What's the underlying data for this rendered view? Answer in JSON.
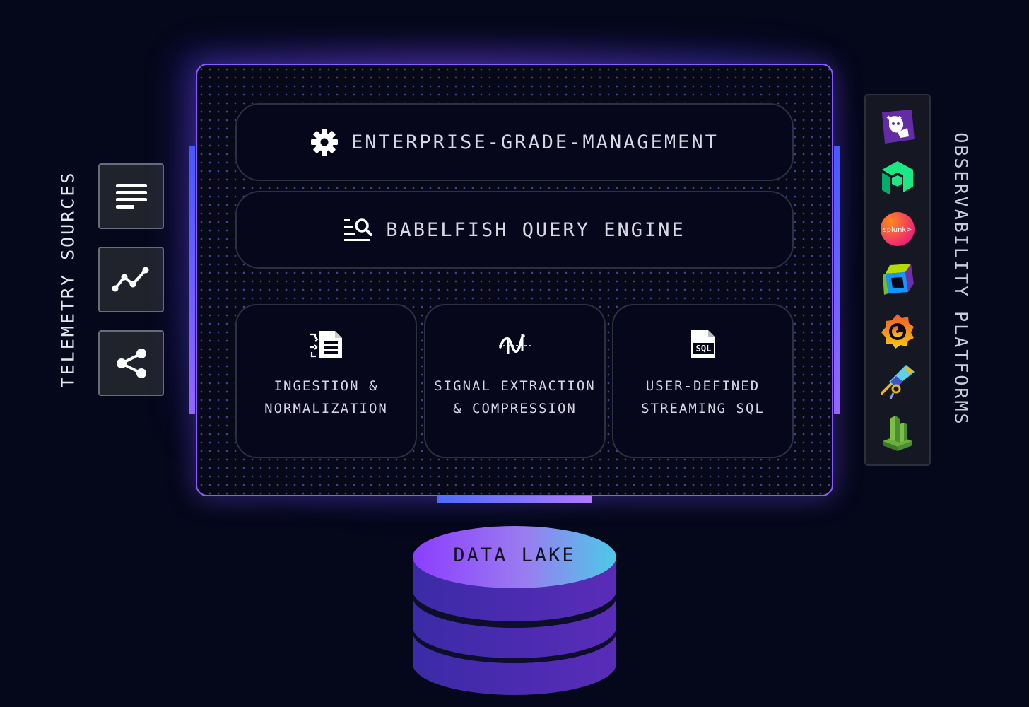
{
  "telemetry_sources": {
    "title": "TELEMETRY SOURCES",
    "items": [
      {
        "icon": "logs-lines-icon"
      },
      {
        "icon": "metrics-line-chart-icon"
      },
      {
        "icon": "traces-share-icon"
      }
    ]
  },
  "platform": {
    "management": {
      "icon": "gear-icon",
      "label": "ENTERPRISE-GRADE-MANAGEMENT"
    },
    "query_engine": {
      "icon": "search-list-icon",
      "label": "BABELFISH QUERY ENGINE"
    },
    "modules": [
      {
        "icon": "ingest-document-icon",
        "line1": "INGESTION &",
        "line2": "NORMALIZATION"
      },
      {
        "icon": "signal-wave-icon",
        "line1": "SIGNAL EXTRACTION",
        "line2": "& COMPRESSION"
      },
      {
        "icon": "sql-file-icon",
        "icon_text": "SQL",
        "line1": "USER-DEFINED",
        "line2": "STREAMING SQL"
      }
    ]
  },
  "observability_platforms": {
    "title": "OBSERVABILITY PLATFORMS",
    "logos": [
      {
        "icon": "datadog-logo-icon"
      },
      {
        "icon": "newrelic-logo-icon"
      },
      {
        "icon": "splunk-logo-icon",
        "text": "splunk>"
      },
      {
        "icon": "dynatrace-cube-logo-icon"
      },
      {
        "icon": "grafana-logo-icon"
      },
      {
        "icon": "jaeger-telescope-logo-icon"
      },
      {
        "icon": "cloudwatch-logo-icon"
      }
    ]
  },
  "data_lake": {
    "label": "DATA LAKE"
  },
  "colors": {
    "background": "#05071a",
    "panel_border": "#8a5cff",
    "accent_blue": "#3a5cff",
    "accent_purple": "#9a6cff",
    "lake_top_start": "#8b3dff",
    "lake_top_end": "#4cc9e8",
    "lake_body": "#4a2bb0"
  }
}
